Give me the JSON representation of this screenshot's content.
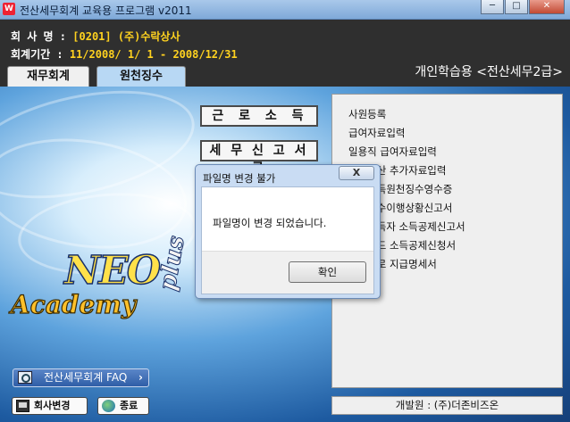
{
  "window": {
    "title": "전산세무회계 교육용 프로그램 v2011",
    "minimize": "─",
    "maximize": "□",
    "close": "✕"
  },
  "header": {
    "company_label": "회 사 명 :",
    "company_value": "[0201] (주)수락상사",
    "period_label": "회계기간 :",
    "period_value": "11/2008/ 1/ 1 - 2008/12/31",
    "tabs": [
      {
        "label": "재무회계",
        "active": true
      },
      {
        "label": "원천징수",
        "active": false
      }
    ],
    "mode_title": "개인학습용 <전산세무2급>"
  },
  "menu": {
    "buttons": [
      "근 로 소 득",
      "세 무 신 고 서 류"
    ]
  },
  "logo": {
    "neo": "NEO",
    "plus": "plus",
    "academy": "Academy"
  },
  "right_panel": {
    "items": [
      "사원등록",
      "급여자료입력",
      "일용직 급여자료입력",
      "연말정산 추가자료입력",
      "근로소득원천징수영수증",
      "원천징수이행상황신고서",
      "근로소득자 소득공제신고서",
      "신용카드 소득공제신청서",
      "일용근로 지급명세서"
    ],
    "developer": "개발원 : (주)더존비즈온"
  },
  "bottom": {
    "faq_label": "전산세무회계 FAQ",
    "faq_chevron": "›",
    "change_company": "회사변경",
    "exit": "종료"
  },
  "dialog": {
    "title": "파일명 변경 불가",
    "close": "X",
    "message": "파일명이 변경 되었습니다.",
    "ok": "확인"
  },
  "colors": {
    "header_bg": "#2f2f2f",
    "header_value": "#ffd21f",
    "dialog_frame": "#c9dcf3",
    "main_bg": "#1d5aa0"
  }
}
